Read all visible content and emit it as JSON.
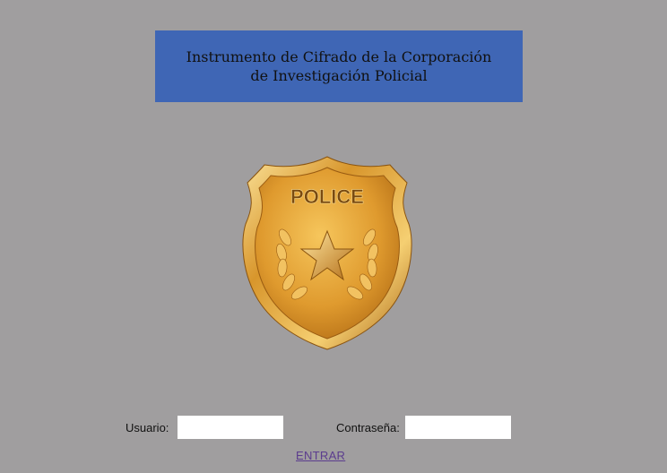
{
  "header": {
    "title": "Instrumento de Cifrado de la Corporación de Investigación Policial"
  },
  "badge": {
    "text": "POLICE",
    "icon": "police-badge-icon"
  },
  "login": {
    "user_label": "Usuario:",
    "user_value": "",
    "password_label": "Contraseña:",
    "password_value": "",
    "enter_label": "ENTRAR"
  },
  "colors": {
    "background": "#a09e9f",
    "title_box": "#3f66b5",
    "link": "#5b3c8e",
    "badge_gold": "#e0a23a"
  }
}
